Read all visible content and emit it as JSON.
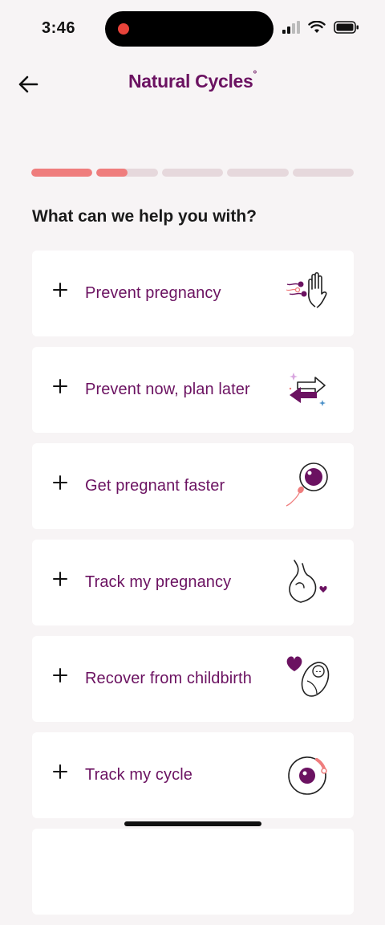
{
  "status_bar": {
    "time": "3:46"
  },
  "header": {
    "logo_text": "Natural Cycles",
    "logo_mark": "°"
  },
  "progress": {
    "total_steps": 5,
    "segments": [
      1,
      0.5,
      0,
      0,
      0
    ]
  },
  "question": "What can we help you with?",
  "options": [
    {
      "label": "Prevent pregnancy",
      "icon": "sperm-hand-icon"
    },
    {
      "label": "Prevent now, plan later",
      "icon": "switch-arrows-icon"
    },
    {
      "label": "Get pregnant faster",
      "icon": "egg-sperm-icon"
    },
    {
      "label": "Track my pregnancy",
      "icon": "pregnant-belly-icon"
    },
    {
      "label": "Recover from childbirth",
      "icon": "baby-heart-icon"
    },
    {
      "label": "Track my cycle",
      "icon": "cycle-ring-icon"
    }
  ],
  "colors": {
    "brand": "#6b1261",
    "accent": "#ef7d7d",
    "track": "#e6d8dc"
  }
}
